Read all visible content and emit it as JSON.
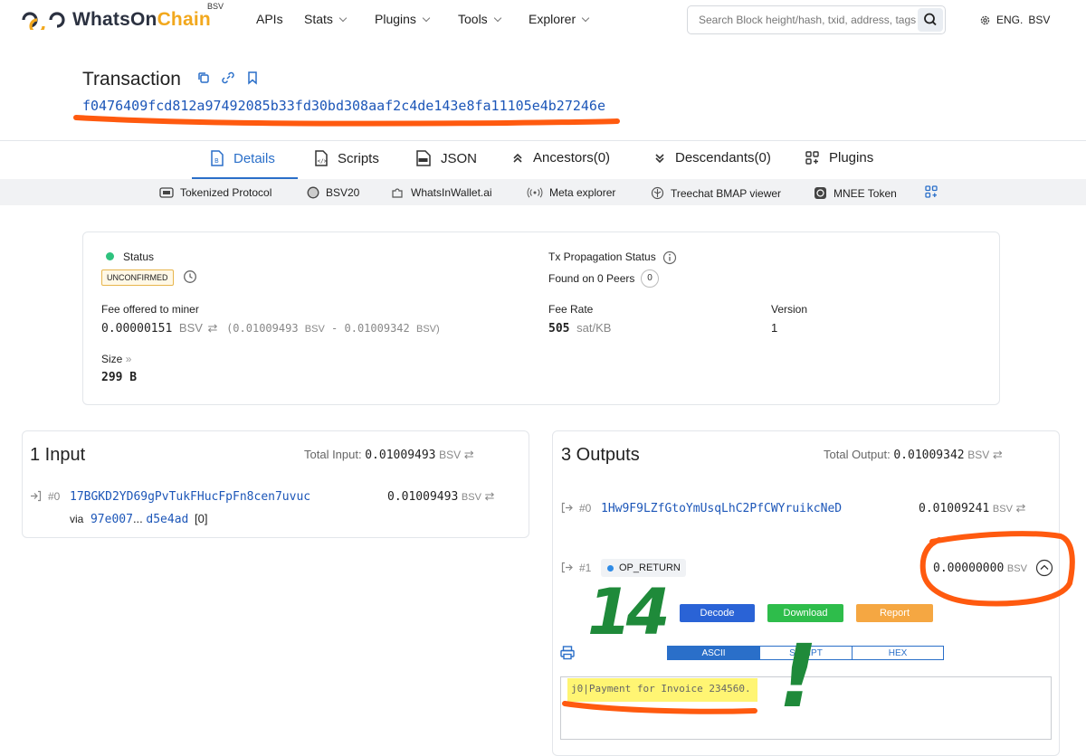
{
  "header": {
    "logo_text_a": "WhatsOn",
    "logo_text_b": "Chain",
    "logo_sup": "BSV",
    "nav": [
      {
        "label": "APIs"
      },
      {
        "label": "Stats"
      },
      {
        "label": "Plugins"
      },
      {
        "label": "Tools"
      },
      {
        "label": "Explorer"
      }
    ],
    "search_placeholder": "Search Block height/hash, txid, address, tags",
    "lang": "ENG.",
    "network": "BSV"
  },
  "tx": {
    "title": "Transaction",
    "txid": "f0476409fcd812a97492085b33fd30bd308aaf2c4de143e8fa11105e4b27246e"
  },
  "tabs": [
    {
      "label": "Details"
    },
    {
      "label": "Scripts"
    },
    {
      "label": "JSON"
    },
    {
      "label": "Ancestors(0)"
    },
    {
      "label": "Descendants(0)"
    },
    {
      "label": "Plugins"
    }
  ],
  "plugins": [
    {
      "label": "Tokenized Protocol"
    },
    {
      "label": "BSV20"
    },
    {
      "label": "WhatsInWallet.ai"
    },
    {
      "label": "Meta explorer"
    },
    {
      "label": "Treechat BMAP viewer"
    },
    {
      "label": "MNEE Token"
    }
  ],
  "summary": {
    "status_label": "Status",
    "status_value": "UNCONFIRMED",
    "prop_label": "Tx Propagation Status",
    "found_label": "Found on 0 Peers",
    "found_count": "0",
    "fee_label": "Fee offered to miner",
    "fee_value": "0.00000151",
    "fee_unit": "BSV",
    "fee_detail_a": "(0.01009493",
    "fee_detail_b": "BSV",
    "fee_detail_c": "- 0.01009342",
    "fee_detail_d": "BSV)",
    "rate_label": "Fee Rate",
    "rate_value": "505",
    "rate_unit": "sat/KB",
    "version_label": "Version",
    "version_value": "1",
    "size_label": "Size",
    "size_value": "299 B"
  },
  "inputs": {
    "title": "1 Input",
    "total_label": "Total Input:",
    "total_value": "0.01009493",
    "total_unit": "BSV",
    "items": [
      {
        "index": "#0",
        "address": "17BGKD2YD69gPvTukFHucFpFn8cen7uvuc",
        "amount": "0.01009493",
        "unit": "BSV",
        "via": "via",
        "via_a": "97e007",
        "via_sep": "...",
        "via_b": "d5e4ad",
        "via_idx": "[0]"
      }
    ]
  },
  "outputs": {
    "title": "3 Outputs",
    "total_label": "Total Output:",
    "total_value": "0.01009342",
    "total_unit": "BSV",
    "items": [
      {
        "index": "#0",
        "address": "1Hw9F9LZfGtoYmUsqLhC2PfCWYruikcNeD",
        "amount": "0.01009241",
        "unit": "BSV"
      },
      {
        "index": "#1",
        "type": "OP_RETURN",
        "amount": "0.00000000",
        "unit": "BSV"
      }
    ],
    "buttons": {
      "decode": "Decode",
      "download": "Download",
      "report": "Report"
    },
    "segments": [
      "ASCII",
      "SCRIPT",
      "HEX"
    ],
    "ascii_text": "j0|Payment for Invoice 234560."
  },
  "annotations": {
    "number": "14",
    "mark": "!"
  },
  "colors": {
    "link": "#1c56b8",
    "accent": "#2a6fc9",
    "decode": "#2a63d6",
    "download": "#2ebd4b",
    "report": "#f5a742",
    "scribble_orange": "#ff5a0f",
    "scribble_green": "#1f8a3a",
    "highlight": "#fff35a"
  }
}
